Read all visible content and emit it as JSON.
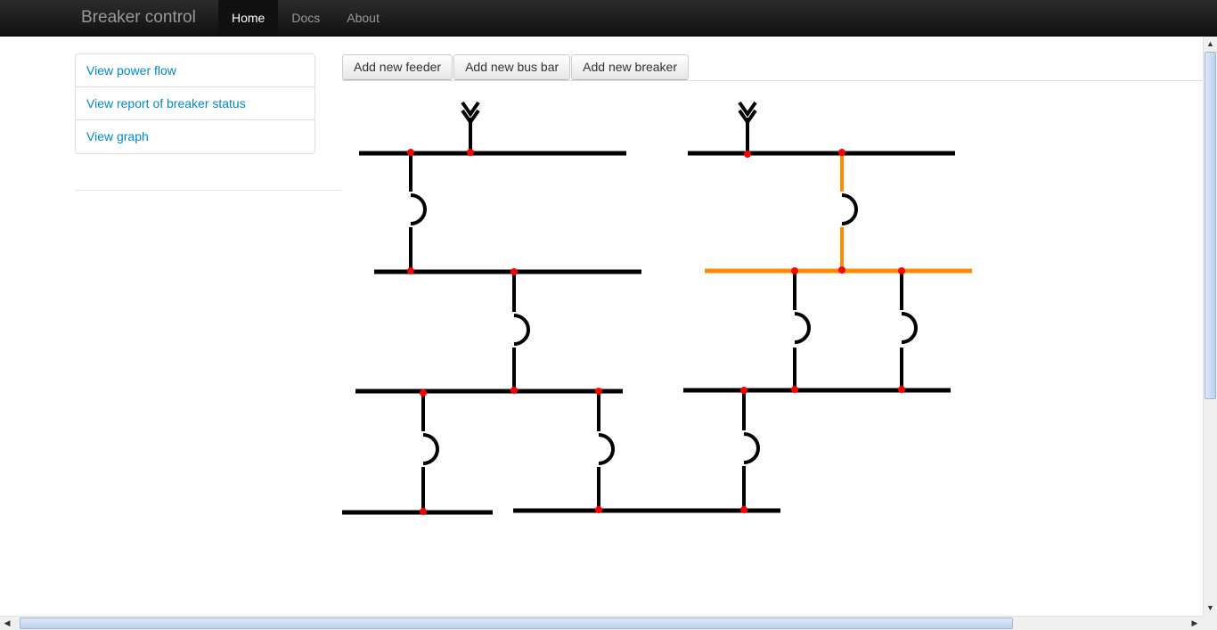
{
  "navbar": {
    "brand": "Breaker control",
    "items": [
      {
        "label": "Home",
        "active": true
      },
      {
        "label": "Docs",
        "active": false
      },
      {
        "label": "About",
        "active": false
      }
    ]
  },
  "sidebar": {
    "links": [
      "View power flow",
      "View report of breaker status",
      "View graph"
    ]
  },
  "toolbar": {
    "buttons": [
      "Add new feeder",
      "Add new bus bar",
      "Add new breaker"
    ]
  },
  "colors": {
    "line": "#000000",
    "energized": "#ff8c00",
    "node": "#ff0000"
  },
  "icons": {
    "feeder": "feeder-arrow-icon",
    "breaker": "breaker-arc-icon"
  }
}
